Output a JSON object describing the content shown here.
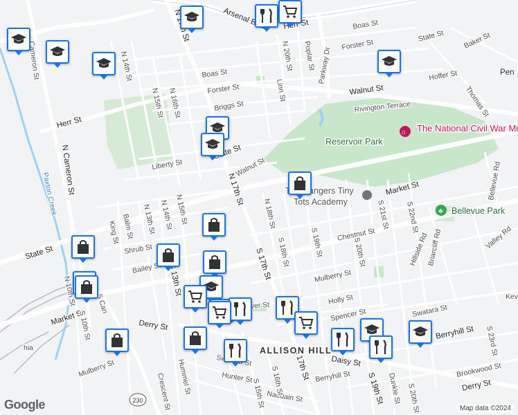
{
  "map": {
    "attribution": "Map data ©2024",
    "logo": "Google",
    "streets": {
      "arsenal_blvd": "Arsenal Blvd",
      "herr_st_top": "Herr St",
      "herr_st_left": "Herr St",
      "boas_st_right": "Boas St",
      "forster_st_right": "Forster St",
      "state_st_right": "State St",
      "baker_st": "Baker St",
      "hoffer_st": "Hoffer St",
      "thomas_st": "Thomas St",
      "walnut_st_right": "Walnut St",
      "rivington_terrace": "Rivington Terrace",
      "parkway_dr": "Parkway Dr",
      "poplar_st": "Poplar St",
      "n_20th_st": "N 20th St",
      "linn_st": "Linn St",
      "n_17th_st_top": "N 17th St",
      "n_17th_st_mid": "N 17th St",
      "boas_st": "Boas St",
      "forster_st": "Forster St",
      "briggs_st": "Briggs St",
      "n_16th_st": "N 16th St",
      "n_15th_st": "N 15th St",
      "n_14th_st": "N 14th St",
      "state_st_mid": "State St",
      "liberty_st": "Liberty St",
      "walnut_st_mid": "Walnut St",
      "n_cameron_st": "N Cameron St",
      "cameron_st": "Cameron St",
      "paxton_creek": "Paxton Creek",
      "state_st_left": "State St",
      "n_13th_st": "N 13th St",
      "n_14th_st_low": "N 14th St",
      "n_15th_st_low": "N 15th St",
      "balm_st": "Balm St",
      "king_st": "King St",
      "shrub_st": "Shrub St",
      "bailey_st": "Bailey St",
      "s_13th_st": "S 13th St",
      "s_17th_st": "S 17th St",
      "n_18th_st": "N 18th St",
      "s_18th_st": "S 18th St",
      "s_19th_st": "S 19th St",
      "s_20th_st": "S 20th St",
      "s_21st_st": "S 21st St",
      "s_22nd_st": "S 22nd St",
      "market_st_right": "Market St",
      "market_st_left": "Market St",
      "chestnut_st": "Chestnut St",
      "mulberry_st": "Mulberry St",
      "mulberry_st_left": "Mulberry St",
      "holly_st": "Holly St",
      "spencer_st": "Spencer St",
      "swatara_st": "Swatara St",
      "swatara_st_low": "Swatara St",
      "berryhill_st": "Berryhill St",
      "berryhill_st_low": "Berryhill St",
      "derry_st_left": "Derry St",
      "derry_st_right": "Derry St",
      "brookwood_st": "Brookwood St",
      "hillside_rd": "Hillside Rd",
      "briarcliff_rd": "Briarcliff Rd",
      "valley_rd": "Valley Rd",
      "bellevue_rd": "Bellevue Rd",
      "n_10th_st": "N 10th St",
      "s_10th_st": "S 10th St",
      "s_cameron_st": "S Cameron St",
      "hummel_st": "Hummel St",
      "crescent_st": "Crescent St",
      "hunter_st": "Hunter St",
      "naudain_st": "Naudain St",
      "s_15th_st": "S 15th St",
      "s_16th_st": "S 16th St",
      "s_17th_st_low": "S 17th St",
      "s_19th_st_low": "S 19th St",
      "s_20th_st_low": "S 20th St",
      "dunkle_st": "Dunkle St",
      "s_23rd_st": "S 23rd St",
      "route_230": "230",
      "daisy_st": "Daisy St",
      "river_st": "ver St",
      "s_can": "S Can",
      "n_16th_st_low": "St",
      "n_17th_st_st": "St",
      "pen": "Pen",
      "kev": "Kev",
      "hia": "hia"
    },
    "district": "ALLISON HILL",
    "pois": {
      "museum": "The National Civil War Museum",
      "reservoir_park": "Reservoir Park",
      "bellevue_park": "Bellevue Park",
      "tiny_tots_line1": "The Rangers Tiny",
      "tiny_tots_line2": "Tots Academy"
    },
    "colors": {
      "background": "#f1f3f4",
      "park": "#c8e6c9",
      "water": "#9fd1f5",
      "road": "#ffffff",
      "marker_border": "#1a73e8",
      "museum_pink": "#c2185b",
      "park_green": "#34a853"
    },
    "markers": [
      {
        "name": "graduation-cap-marker",
        "icon": "graduation-cap-icon"
      },
      {
        "name": "graduation-cap-marker",
        "icon": "graduation-cap-icon"
      },
      {
        "name": "graduation-cap-marker",
        "icon": "graduation-cap-icon"
      },
      {
        "name": "graduation-cap-marker",
        "icon": "graduation-cap-icon"
      },
      {
        "name": "restaurant-marker",
        "icon": "fork-knife-icon"
      },
      {
        "name": "grocery-cart-marker",
        "icon": "shopping-cart-icon"
      },
      {
        "name": "graduation-cap-marker",
        "icon": "graduation-cap-icon"
      },
      {
        "name": "graduation-cap-marker",
        "icon": "graduation-cap-icon"
      },
      {
        "name": "shopping-bag-marker",
        "icon": "shopping-bag-icon"
      },
      {
        "name": "shopping-bag-marker",
        "icon": "shopping-bag-icon"
      },
      {
        "name": "restaurant-marker",
        "icon": "fork-knife-icon"
      },
      {
        "name": "shopping-bag-marker",
        "icon": "shopping-bag-icon"
      },
      {
        "name": "shopping-bag-marker",
        "icon": "shopping-bag-icon"
      },
      {
        "name": "graduation-cap-marker",
        "icon": "graduation-cap-icon"
      },
      {
        "name": "grocery-cart-marker",
        "icon": "shopping-cart-icon"
      },
      {
        "name": "grocery-cart-marker",
        "icon": "shopping-cart-icon"
      },
      {
        "name": "restaurant-marker",
        "icon": "fork-knife-icon"
      },
      {
        "name": "shopping-bag-marker",
        "icon": "shopping-bag-icon"
      },
      {
        "name": "restaurant-marker",
        "icon": "fork-knife-icon"
      },
      {
        "name": "shopping-bag-marker",
        "icon": "shopping-bag-icon"
      },
      {
        "name": "restaurant-marker",
        "icon": "fork-knife-icon"
      },
      {
        "name": "grocery-cart-marker",
        "icon": "shopping-cart-icon"
      },
      {
        "name": "graduation-cap-marker",
        "icon": "graduation-cap-icon"
      },
      {
        "name": "restaurant-marker",
        "icon": "fork-knife-icon"
      },
      {
        "name": "restaurant-marker",
        "icon": "fork-knife-icon"
      },
      {
        "name": "graduation-cap-marker",
        "icon": "graduation-cap-icon"
      },
      {
        "name": "shopping-bag-marker",
        "icon": "shopping-bag-icon"
      },
      {
        "name": "shopping-bag-marker",
        "icon": "shopping-bag-icon"
      },
      {
        "name": "graduation-cap-marker",
        "icon": "graduation-cap-icon"
      },
      {
        "name": "grocery-cart-marker",
        "icon": "shopping-cart-icon"
      }
    ]
  }
}
